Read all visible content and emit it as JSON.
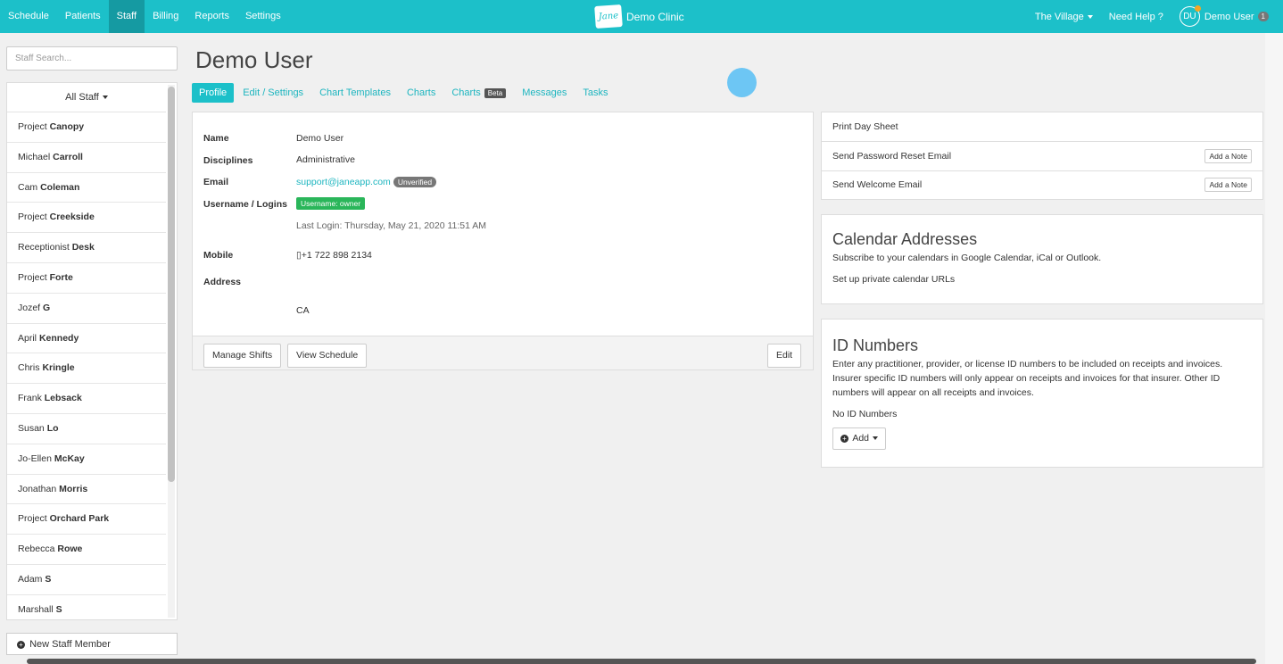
{
  "topbar": {
    "nav": [
      {
        "label": "Schedule",
        "active": false
      },
      {
        "label": "Patients",
        "active": false
      },
      {
        "label": "Staff",
        "active": true
      },
      {
        "label": "Billing",
        "active": false
      },
      {
        "label": "Reports",
        "active": false
      },
      {
        "label": "Settings",
        "active": false
      }
    ],
    "brand_logo": "Jane",
    "brand_name": "Demo Clinic",
    "location": "The Village",
    "help": "Need Help ?",
    "avatar_initials": "DU",
    "user_name": "Demo User",
    "notification_count": "1",
    "color": "#1cc0c9"
  },
  "sidebar": {
    "search_placeholder": "Staff Search...",
    "filter_label": "All Staff",
    "staff": [
      {
        "first": "Project",
        "last": "Canopy"
      },
      {
        "first": "Michael",
        "last": "Carroll"
      },
      {
        "first": "Cam",
        "last": "Coleman"
      },
      {
        "first": "Project",
        "last": "Creekside"
      },
      {
        "first": "Receptionist",
        "last": "Desk"
      },
      {
        "first": "Project",
        "last": "Forte"
      },
      {
        "first": "Jozef",
        "last": "G"
      },
      {
        "first": "April",
        "last": "Kennedy"
      },
      {
        "first": "Chris",
        "last": "Kringle"
      },
      {
        "first": "Frank",
        "last": "Lebsack"
      },
      {
        "first": "Susan",
        "last": "Lo"
      },
      {
        "first": "Jo-Ellen",
        "last": "McKay"
      },
      {
        "first": "Jonathan",
        "last": "Morris"
      },
      {
        "first": "Project",
        "last": "Orchard Park"
      },
      {
        "first": "Rebecca",
        "last": "Rowe"
      },
      {
        "first": "Adam",
        "last": "S"
      },
      {
        "first": "Marshall",
        "last": "S"
      }
    ],
    "new_staff_label": "New Staff Member"
  },
  "main": {
    "title": "Demo User",
    "tabs": [
      {
        "label": "Profile",
        "active": true
      },
      {
        "label": "Edit / Settings"
      },
      {
        "label": "Chart Templates"
      },
      {
        "label": "Charts"
      },
      {
        "label": "Charts",
        "badge": "Beta"
      },
      {
        "label": "Messages"
      },
      {
        "label": "Tasks"
      }
    ],
    "profile": {
      "name_label": "Name",
      "name_value": "Demo User",
      "disciplines_label": "Disciplines",
      "disciplines_value": "Administrative",
      "email_label": "Email",
      "email_value": "support@janeapp.com",
      "email_status": "Unverified",
      "username_label": "Username / Logins",
      "username_badge": "Username: owner",
      "last_login": "Last Login: Thursday, May 21, 2020 11:51 AM",
      "mobile_label": "Mobile",
      "mobile_value": "+1 722 898 2134",
      "address_label": "Address",
      "address_value": "CA"
    },
    "footer": {
      "manage_shifts": "Manage Shifts",
      "view_schedule": "View Schedule",
      "edit": "Edit"
    }
  },
  "right": {
    "actions": [
      {
        "label": "Print Day Sheet"
      },
      {
        "label": "Send Password Reset Email",
        "note": "Add a Note"
      },
      {
        "label": "Send Welcome Email",
        "note": "Add a Note"
      }
    ],
    "calendar": {
      "title": "Calendar Addresses",
      "description": "Subscribe to your calendars in Google Calendar, iCal or Outlook.",
      "link": "Set up private calendar URLs"
    },
    "id_numbers": {
      "title": "ID Numbers",
      "description": "Enter any practitioner, provider, or license ID numbers to be included on receipts and invoices. Insurer specific ID numbers will only appear on receipts and invoices for that insurer. Other ID numbers will appear on all receipts and invoices.",
      "empty": "No ID Numbers",
      "add_label": "Add"
    }
  }
}
